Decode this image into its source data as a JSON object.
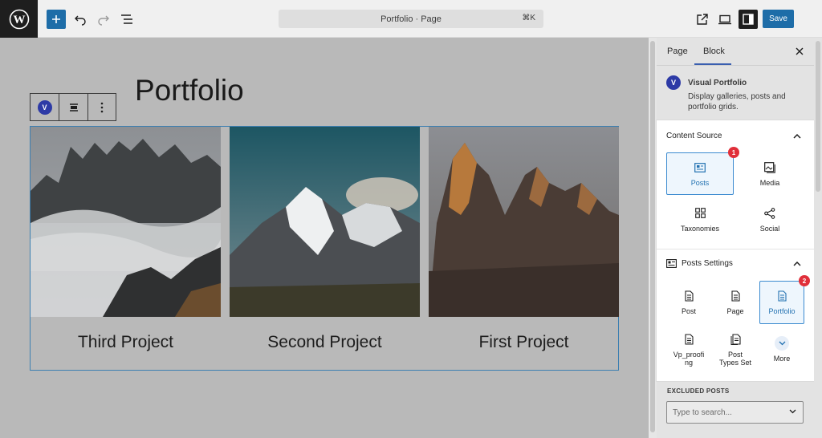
{
  "topbar": {
    "document_title": "Portfolio · Page",
    "shortcut": "⌘K",
    "save_label": "Save",
    "icons": [
      "wordpress-icon",
      "plus-icon",
      "undo-icon",
      "redo-icon",
      "list-view-icon",
      "external-link-icon",
      "desktop-preview-icon",
      "sidebar-toggle-icon"
    ]
  },
  "canvas": {
    "page_title": "Portfolio",
    "block_toolbar": {
      "logo_letter": "V",
      "icons": [
        "visual-portfolio-icon",
        "align-icon",
        "more-vertical-icon"
      ]
    },
    "projects": [
      {
        "title": "Third Project",
        "image": "misty-mountains"
      },
      {
        "title": "Second Project",
        "image": "snowy-peak"
      },
      {
        "title": "First Project",
        "image": "sunlit-peaks"
      }
    ]
  },
  "sidebar": {
    "tabs": [
      {
        "label": "Page",
        "active": false
      },
      {
        "label": "Block",
        "active": true
      }
    ],
    "block_card": {
      "logo_letter": "V",
      "name": "Visual Portfolio",
      "description": "Display galleries, posts and portfolio grids."
    },
    "content_source": {
      "title": "Content Source",
      "badge": "1",
      "options": [
        {
          "label": "Posts",
          "icon": "posts-icon",
          "selected": true
        },
        {
          "label": "Media",
          "icon": "media-icon",
          "selected": false
        },
        {
          "label": "Taxonomies",
          "icon": "taxonomies-icon",
          "selected": false
        },
        {
          "label": "Social",
          "icon": "share-icon",
          "selected": false
        }
      ]
    },
    "posts_settings": {
      "title": "Posts Settings",
      "badge": "2",
      "options": [
        {
          "label": "Post",
          "icon": "document-icon",
          "selected": false
        },
        {
          "label": "Page",
          "icon": "document-icon",
          "selected": false
        },
        {
          "label": "Portfolio",
          "icon": "document-icon",
          "selected": true
        },
        {
          "label": "Vp_proofi ng",
          "icon": "document-icon",
          "selected": false
        },
        {
          "label": "Post Types Set",
          "icon": "documents-icon",
          "selected": false
        },
        {
          "label": "More",
          "icon": "chevron-down-icon",
          "selected": false
        }
      ]
    },
    "excluded_posts": {
      "label": "EXCLUDED POSTS",
      "placeholder": "Type to search..."
    }
  },
  "colors": {
    "accent": "#2271b1",
    "badge": "#e02f3a",
    "dark": "#1e1e1e",
    "canvas_overlay": "#b9b9b9"
  }
}
